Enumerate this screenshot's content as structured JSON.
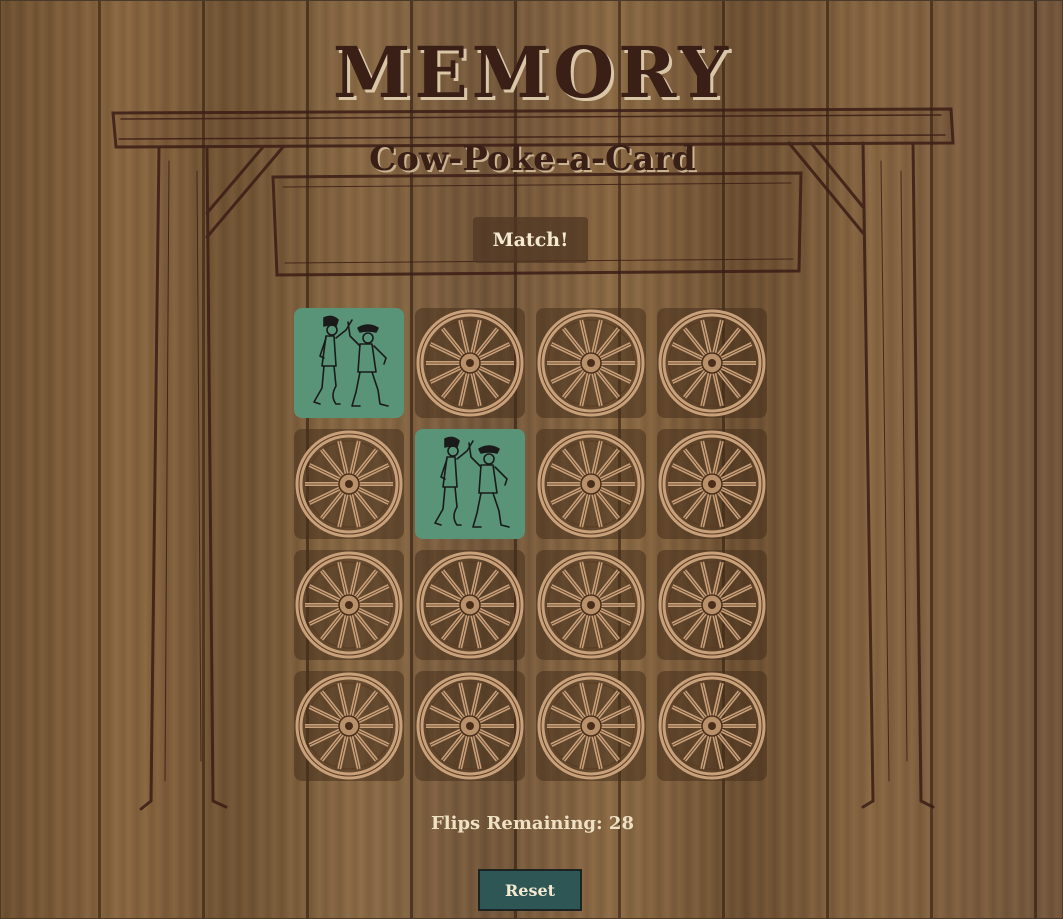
{
  "game": {
    "title": "MEMORY",
    "subtitle": "Cow-Poke-a-Card",
    "status_message": "Match!",
    "flips_label": "Flips Remaining: 28",
    "reset_label": "Reset"
  },
  "board": {
    "rows": 4,
    "columns": 4,
    "card_back_icon": "wagon-wheel-icon",
    "card_face_icon": "dancing-cowboys-icon",
    "cards": [
      {
        "state": "face-up",
        "icon": "dancing-cowboys-icon"
      },
      {
        "state": "face-down",
        "icon": "wagon-wheel-icon"
      },
      {
        "state": "face-down",
        "icon": "wagon-wheel-icon"
      },
      {
        "state": "face-down",
        "icon": "wagon-wheel-icon"
      },
      {
        "state": "face-down",
        "icon": "wagon-wheel-icon"
      },
      {
        "state": "face-up",
        "icon": "dancing-cowboys-icon"
      },
      {
        "state": "face-down",
        "icon": "wagon-wheel-icon"
      },
      {
        "state": "face-down",
        "icon": "wagon-wheel-icon"
      },
      {
        "state": "face-down",
        "icon": "wagon-wheel-icon"
      },
      {
        "state": "face-down",
        "icon": "wagon-wheel-icon"
      },
      {
        "state": "face-down",
        "icon": "wagon-wheel-icon"
      },
      {
        "state": "face-down",
        "icon": "wagon-wheel-icon"
      },
      {
        "state": "face-down",
        "icon": "wagon-wheel-icon"
      },
      {
        "state": "face-down",
        "icon": "wagon-wheel-icon"
      },
      {
        "state": "face-down",
        "icon": "wagon-wheel-icon"
      },
      {
        "state": "face-down",
        "icon": "wagon-wheel-icon"
      }
    ]
  },
  "colors": {
    "title_text": "#3a1f17",
    "face_up_card": "#5a9478",
    "reset_button": "#2d5654",
    "light_text": "#efe2c4"
  }
}
